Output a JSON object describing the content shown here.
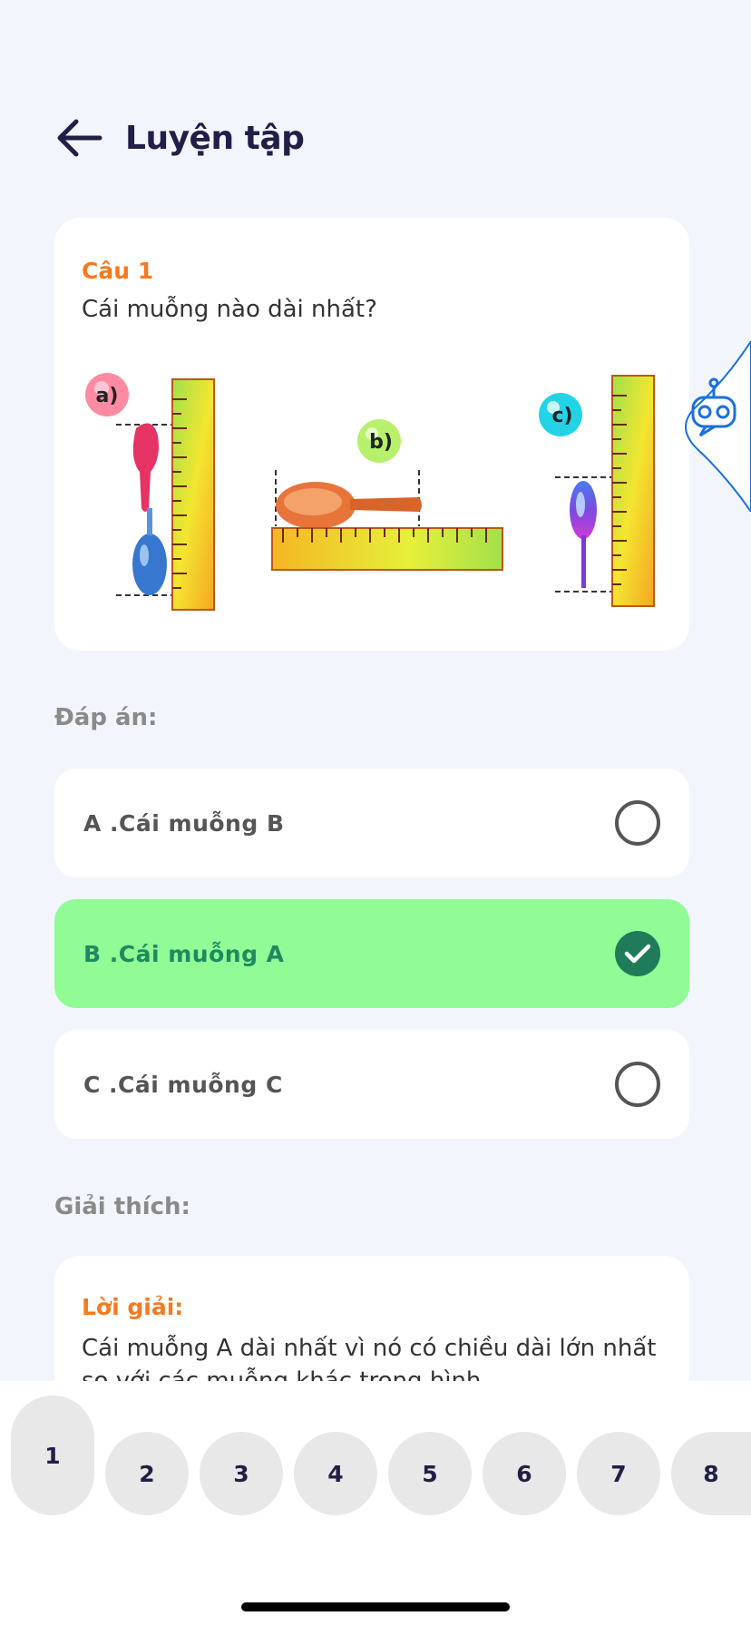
{
  "header": {
    "title": "Luyện tập",
    "back_icon": "arrow-left-icon"
  },
  "question": {
    "number": "Câu 1",
    "text": "Cái muỗng nào dài nhất?",
    "image_labels": {
      "a": "a)",
      "b": "b)",
      "c": "c)"
    }
  },
  "answers_label": "Đáp án:",
  "options": [
    {
      "label": "A .Cái muỗng B",
      "selected": false
    },
    {
      "label": "B .Cái muỗng A",
      "selected": true
    },
    {
      "label": "C .Cái muỗng C",
      "selected": false
    }
  ],
  "explanation_label": "Giải thích:",
  "explanation": {
    "title": "Lời giải:",
    "text": "Cái muỗng A dài nhất vì nó có chiều dài lớn nhất so với các muỗng khác trong hình."
  },
  "pagination": {
    "current": 1,
    "pages": [
      "1",
      "2",
      "3",
      "4",
      "5",
      "6",
      "7",
      "8"
    ]
  },
  "colors": {
    "accent": "#f47a20",
    "selected_bg": "#91fb96",
    "check": "#1f7b5a",
    "title": "#1f1f47",
    "assistant": "#1a6fe0"
  },
  "assistant_icon": "robot-assistant-icon"
}
